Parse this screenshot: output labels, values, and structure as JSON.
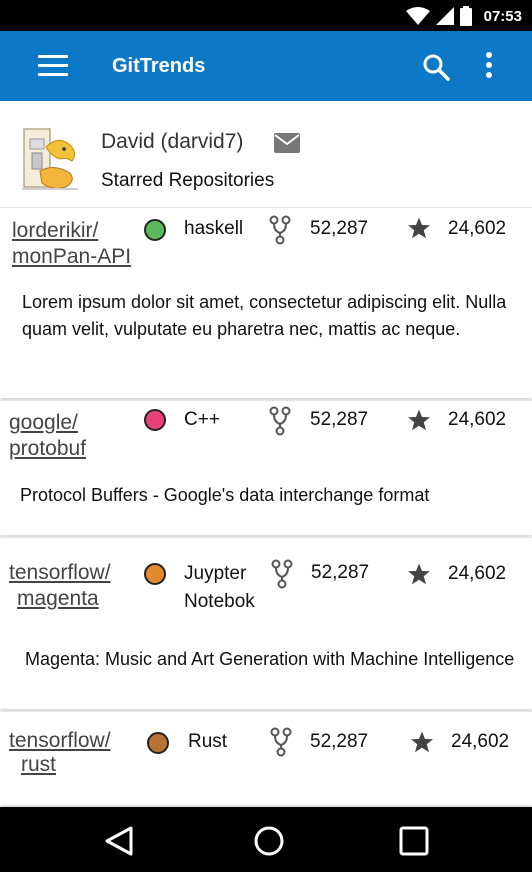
{
  "status_bar": {
    "time": "07:53",
    "icons": [
      "wifi-icon",
      "cell-signal-icon",
      "battery-icon"
    ]
  },
  "app_bar": {
    "title": "GitTrends",
    "color": "#0d78c6",
    "icons": [
      "menu-icon",
      "search-icon",
      "more-vert-icon"
    ]
  },
  "profile": {
    "name": "David (darvid7)",
    "subtitle": "Starred Repositories"
  },
  "repos": [
    {
      "owner": "lorderikir/",
      "name": "monPan-API",
      "language": "haskell",
      "language_color": "#5cb85c",
      "forks": "52,287",
      "stars": "24,602",
      "description": "Lorem ipsum dolor sit amet, consectetur adipiscing elit. Nulla quam velit, vulputate eu pharetra nec, mattis ac neque."
    },
    {
      "owner": "google/",
      "name": "protobuf",
      "language": "C++",
      "language_color": "#e8417a",
      "forks": "52,287",
      "stars": "24,602",
      "description": "Protocol Buffers - Google's data interchange format"
    },
    {
      "owner": "tensorflow/",
      "name": "magenta",
      "language": "Juypter Notebok",
      "language_line1": "Juypter",
      "language_line2": "Notebok",
      "language_color": "#e08a2c",
      "forks": "52,287",
      "stars": "24,602",
      "description": "Magenta: Music and Art Generation with Machine Intelligence"
    },
    {
      "owner": "tensorflow/",
      "name": "rust",
      "language": "Rust",
      "language_color": "#b87333",
      "forks": "52,287",
      "stars": "24,602",
      "description": ""
    }
  ],
  "nav_bar": {
    "buttons": [
      "back-icon",
      "home-icon",
      "recents-icon"
    ]
  }
}
